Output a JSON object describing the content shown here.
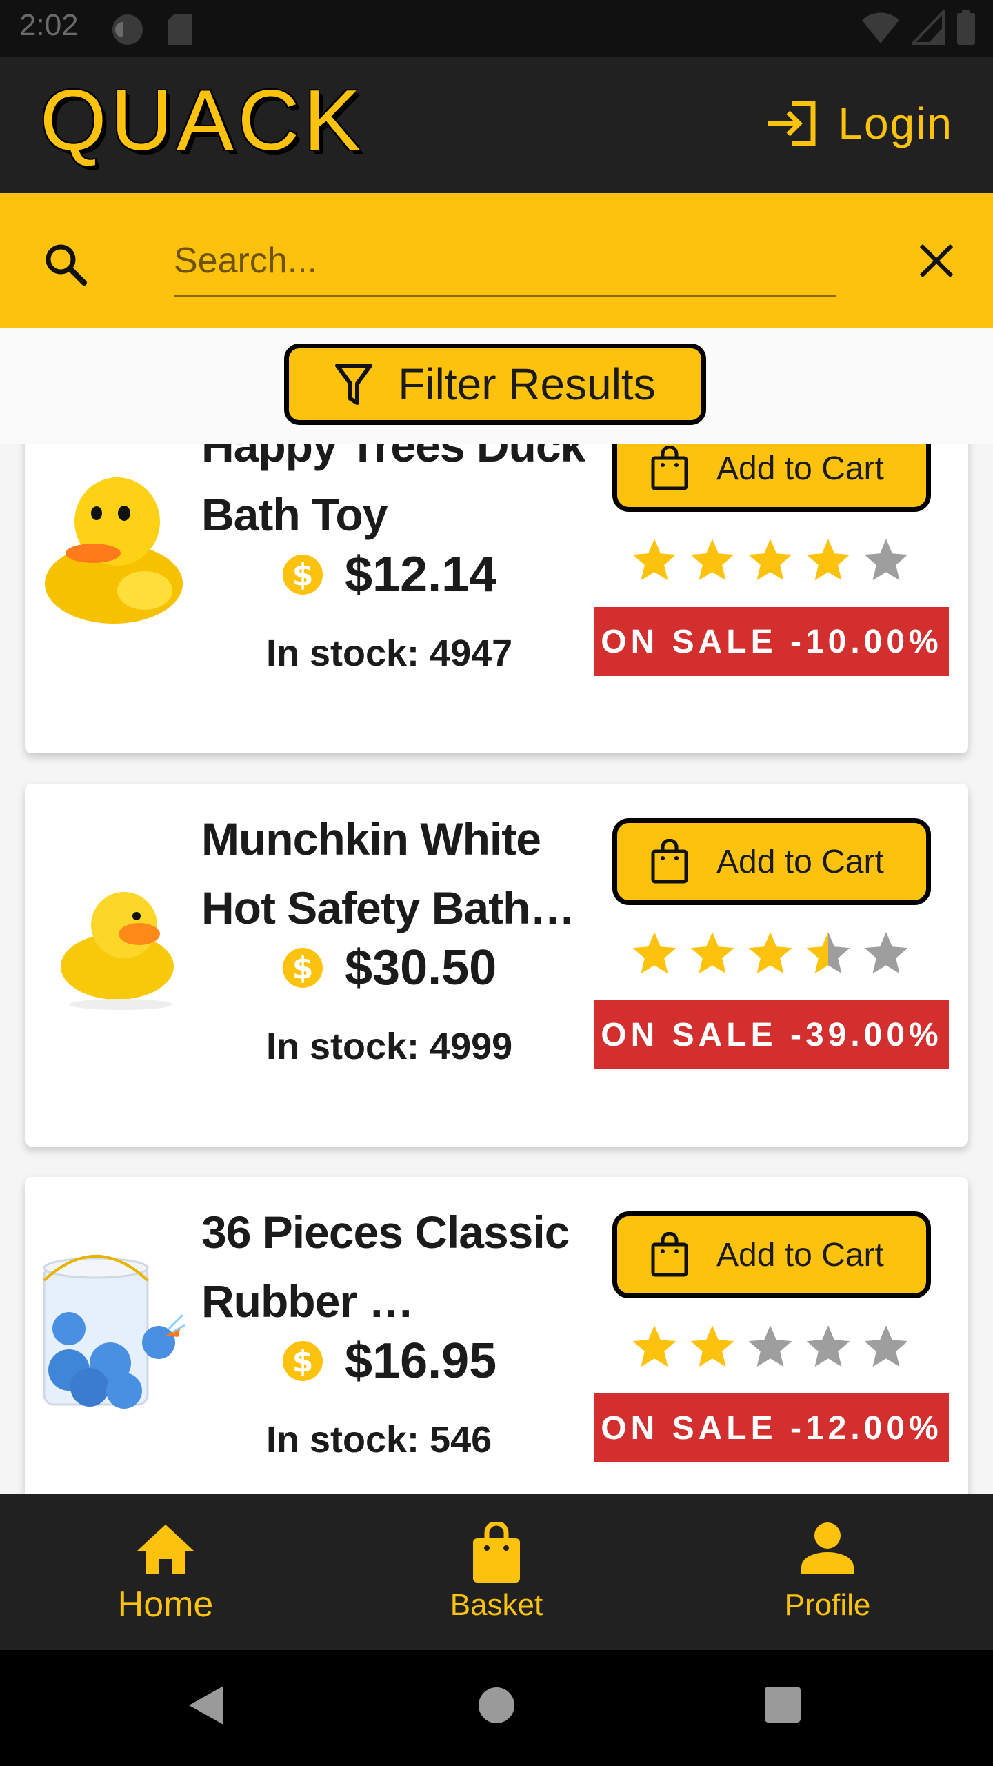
{
  "status_bar": {
    "time": "2:02"
  },
  "header": {
    "logo": "QUACK",
    "login_label": "Login"
  },
  "search": {
    "placeholder": "Search...",
    "value": ""
  },
  "filter": {
    "label": "Filter Results"
  },
  "colors": {
    "accent": "#fcc20d",
    "dark": "#212121",
    "sale": "#d32f2f",
    "star_off": "#9e9e9e"
  },
  "products": [
    {
      "title": "Happy Trees Duck Bath Toy",
      "price": "$12.14",
      "stock": "In stock: 4947",
      "rating": 4,
      "sale": "ON SALE -10.00%",
      "add_label": "Add to Cart",
      "image": "yellow-rubber-duck"
    },
    {
      "title": "Munchkin White Hot Safety Bath…",
      "price": "$30.50",
      "stock": "In stock: 4999",
      "rating": 3.5,
      "sale": "ON SALE -39.00%",
      "add_label": "Add to Cart",
      "image": "yellow-rubber-duck-side"
    },
    {
      "title": "36 Pieces Classic Rubber …",
      "price": "$16.95",
      "stock": "In stock: 546",
      "rating": 2,
      "sale": "ON SALE -12.00%",
      "add_label": "Add to Cart",
      "image": "blue-ducks-bucket"
    }
  ],
  "bottom_nav": {
    "items": [
      {
        "label": "Home",
        "icon": "home-icon"
      },
      {
        "label": "Basket",
        "icon": "basket-icon"
      },
      {
        "label": "Profile",
        "icon": "profile-icon"
      }
    ]
  },
  "system_nav": {
    "icons": [
      "back-icon",
      "home-circle-icon",
      "recents-icon"
    ]
  }
}
